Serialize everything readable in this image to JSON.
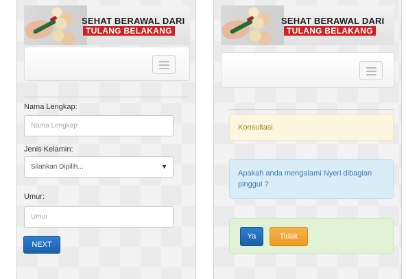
{
  "banner": {
    "line1": "SEHAT BERAWAL DARI",
    "line2": "TULANG BELAKANG"
  },
  "form_screen": {
    "name_label": "Nama Lengkap:",
    "name_placeholder": "Nama Lengkap",
    "gender_label": "Jenis Kelamin:",
    "gender_selected": "Silahkan Dipilih...",
    "age_label": "Umur:",
    "age_placeholder": "Umur",
    "next_button": "NEXT"
  },
  "consult_screen": {
    "section_title": "Konsultasi",
    "question": "Apakah anda mengalami Nyeri dibagian pinggul ?",
    "yes_button": "Ya",
    "no_button": "Tidak"
  },
  "colors": {
    "primary_button": "#1f6bbf",
    "warning_button": "#f0a030",
    "brand_red": "#d31f1f"
  },
  "icons": {
    "menu": "hamburger-menu-icon",
    "select_caret": "caret-down-icon"
  }
}
